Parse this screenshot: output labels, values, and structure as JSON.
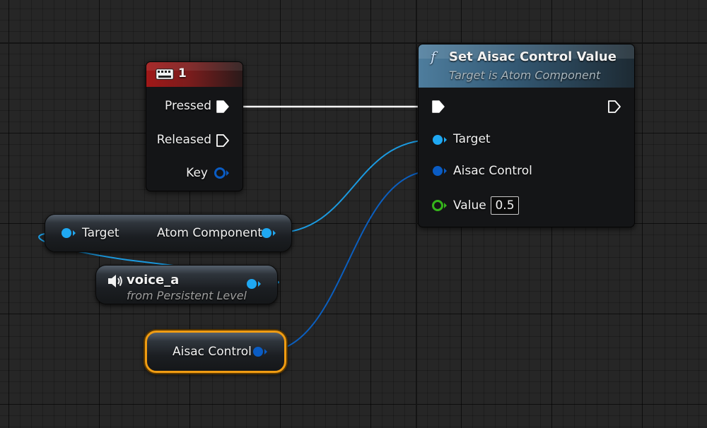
{
  "key_event_node": {
    "title": "1",
    "icon": "keyboard-icon",
    "outputs": [
      {
        "label": "Pressed",
        "pin": "exec-out"
      },
      {
        "label": "Released",
        "pin": "exec-out"
      },
      {
        "label": "Key",
        "pin": "struct-out"
      }
    ]
  },
  "function_node": {
    "icon": "function-icon",
    "icon_glyph": "f",
    "title": "Set Aisac Control Value",
    "subtitle": "Target is Atom Component",
    "inputs": [
      {
        "label": "Target",
        "pin": "object-in"
      },
      {
        "label": "Aisac Control",
        "pin": "struct-in"
      },
      {
        "label": "Value",
        "pin": "float-in",
        "value": "0.5"
      }
    ]
  },
  "cast_node": {
    "input_label": "Target",
    "output_label": "Atom Component"
  },
  "variable_node": {
    "icon": "speaker-icon",
    "name": "voice_a",
    "source": "from Persistent Level"
  },
  "aisac_variable_node": {
    "name": "Aisac Control",
    "selected": true
  },
  "colors": {
    "exec": "#ffffff",
    "object_pin": "#1fa8f2",
    "struct_pin": "#0a5cc4",
    "float_pin": "#35b51b",
    "selection": "#f09c12",
    "key_header": "#a01818",
    "function_header": "#4e7d9d"
  }
}
